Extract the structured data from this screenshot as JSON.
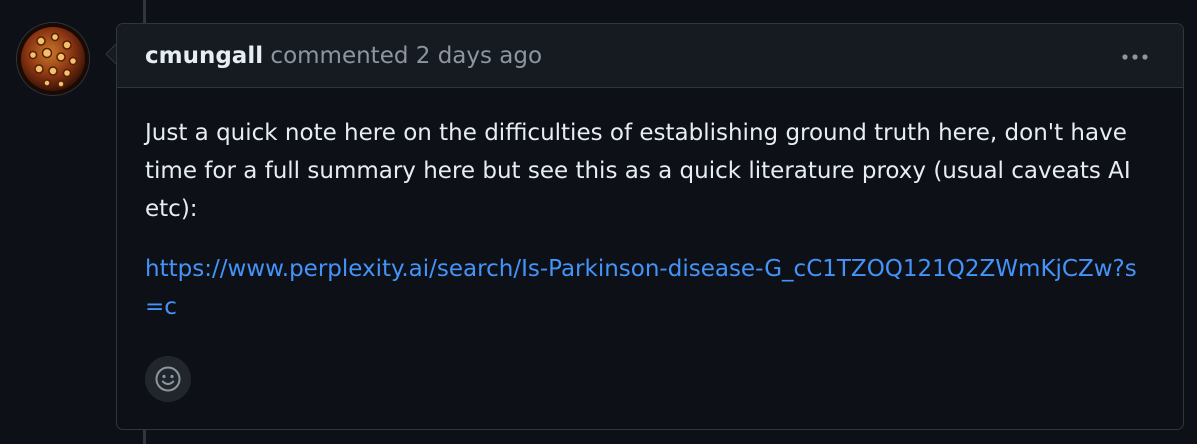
{
  "comment": {
    "author": "cmungall",
    "action": "commented",
    "timestamp": "2 days ago",
    "body_paragraph": "Just a quick note here on the difficulties of establishing ground truth here, don't have time for a full summary here but see this as a quick literature proxy (usual caveats AI etc):",
    "link_text": "https://www.perplexity.ai/search/Is-Parkinson-disease-G_cC1TZOQ121Q2ZWmKjCZw?s=c",
    "link_href": "https://www.perplexity.ai/search/Is-Parkinson-disease-G_cC1TZOQ121Q2ZWmKjCZw?s=c"
  },
  "icons": {
    "menu": "kebab-horizontal-icon",
    "reaction": "smiley-icon"
  },
  "colors": {
    "background": "#0d1117",
    "header_bg": "#161b22",
    "border": "#30363d",
    "text": "#e6edf3",
    "muted": "#8d96a0",
    "link": "#4493f8"
  }
}
